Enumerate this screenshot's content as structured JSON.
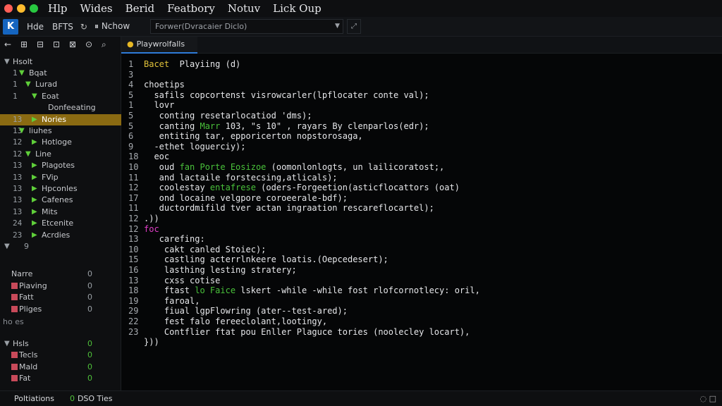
{
  "colors": {
    "accent_blue": "#1565c0",
    "selection": "#8a6a12",
    "keyword_green": "#49c13a",
    "keyword_magenta": "#e03ec8",
    "dot_red": "#ff5f57",
    "dot_yellow": "#febc2e",
    "dot_green": "#28c840"
  },
  "menu": [
    "Hlp",
    "Wides",
    "Berid",
    "Featbory",
    "Notuv",
    "Lick Oup"
  ],
  "toolbar": {
    "logo": "K",
    "items": [
      "Hde",
      "BFTS"
    ],
    "history_label": "Nchow",
    "search_value": "Forwer(Dvracaier Diclo)"
  },
  "sidebar": {
    "tree_title": "Hsolt",
    "tree": [
      {
        "ln": "1",
        "label": "Bqat",
        "arrow": "▼",
        "indent": 1
      },
      {
        "ln": "1",
        "label": "Lurad",
        "arrow": "▼",
        "indent": 2
      },
      {
        "ln": "1",
        "label": "Eoat",
        "arrow": "▼",
        "indent": 3
      },
      {
        "ln": "",
        "label": "Donfeeating",
        "arrow": "",
        "indent": 4
      },
      {
        "ln": "13",
        "label": "Nories",
        "arrow": "▶",
        "indent": 3,
        "selected": true
      },
      {
        "ln": "13",
        "label": "liuhes",
        "arrow": "▼",
        "indent": 1
      },
      {
        "ln": "12",
        "label": "Hotloge",
        "arrow": "▶",
        "indent": 3
      },
      {
        "ln": "12",
        "label": "Line",
        "arrow": "▼",
        "indent": 2
      },
      {
        "ln": "13",
        "label": "Plagotes",
        "arrow": "▶",
        "indent": 3
      },
      {
        "ln": "13",
        "label": "FVip",
        "arrow": "▶",
        "indent": 3
      },
      {
        "ln": "13",
        "label": "Hpconles",
        "arrow": "▶",
        "indent": 3
      },
      {
        "ln": "13",
        "label": "Cafenes",
        "arrow": "▶",
        "indent": 3
      },
      {
        "ln": "13",
        "label": "Mits",
        "arrow": "▶",
        "indent": 3
      },
      {
        "ln": "24",
        "label": "Etcenite",
        "arrow": "▶",
        "indent": 3
      },
      {
        "ln": "23",
        "label": "Acrdies",
        "arrow": "▶",
        "indent": 3
      }
    ],
    "tree_tail": "9",
    "section1": [
      {
        "label": "Narre",
        "value": "0"
      },
      {
        "label": "Piaving",
        "value": "0"
      },
      {
        "label": "Fatt",
        "value": "0"
      },
      {
        "label": "Pliges",
        "value": "0"
      }
    ],
    "divider_label": "ho es",
    "section2_title": "Hsls",
    "section2": [
      {
        "label": "Tecls",
        "value": "0"
      },
      {
        "label": "Mald",
        "value": "0"
      },
      {
        "label": "Fat",
        "value": "0"
      }
    ]
  },
  "tab": {
    "label": "Playwrolfalls"
  },
  "code": [
    {
      "n": "1",
      "text": "Bacet  Playiing (d)"
    },
    {
      "n": "3",
      "text": ""
    },
    {
      "n": "4",
      "text": "choetips"
    },
    {
      "n": "5",
      "text": "  safils copcortenst visrowcarler(lpflocater conte val);"
    },
    {
      "n": "1",
      "text": "  lovr"
    },
    {
      "n": "5",
      "text": "   conting resetarlocatiod 'dms);"
    },
    {
      "n": "5",
      "text": "   canting Marr 103, \"s 10\" , rayars By clenparlos(edr);"
    },
    {
      "n": "6",
      "text": "   entiting tar, epporicerton nopstorosaga,"
    },
    {
      "n": "9",
      "text": "  -ethet loguerciy);"
    },
    {
      "n": "18",
      "text": "  eoc"
    },
    {
      "n": "10",
      "text": "   oud fan Porte Eosizoe (oomonlonlogts, un lailicoratost;,"
    },
    {
      "n": "11",
      "text": "   and lactaile forstecsing,atlicals);"
    },
    {
      "n": "12",
      "text": "   coolestay entafrese (oders-Forgeetion(asticflocattors (oat)"
    },
    {
      "n": "17",
      "text": "   ond locaine velgpore coroeerale-bdf);"
    },
    {
      "n": "11",
      "text": "   ductordmifild tver actan ingraation rescareflocartel);"
    },
    {
      "n": "12",
      "text": ".))"
    },
    {
      "n": "12",
      "text": "foc"
    },
    {
      "n": "13",
      "text": "   carefing:"
    },
    {
      "n": "10",
      "text": "    cakt canled Stoiec);"
    },
    {
      "n": "15",
      "text": "    castling acterrlnkeere loatis.(Oepcedesert);"
    },
    {
      "n": "16",
      "text": "    lasthing lesting stratery;"
    },
    {
      "n": "13",
      "text": "    cxss cotise"
    },
    {
      "n": "18",
      "text": "    ftast lo Faice lskert -while -while fost rlofcornotlecy: oril,"
    },
    {
      "n": "19",
      "text": "    faroal,"
    },
    {
      "n": "29",
      "text": "    fiual lgpFlowring (ater--test-ared);"
    },
    {
      "n": "22",
      "text": "    fest falo fereeclolant,lootingy,"
    },
    {
      "n": "23",
      "text": "    Contflier ftat pou Enller Plaguce tories (noolecley locart),"
    },
    {
      "n": "",
      "text": "}))"
    }
  ],
  "status": {
    "left": "Poltiations",
    "count": "0",
    "count_label": "DSO Ties"
  }
}
